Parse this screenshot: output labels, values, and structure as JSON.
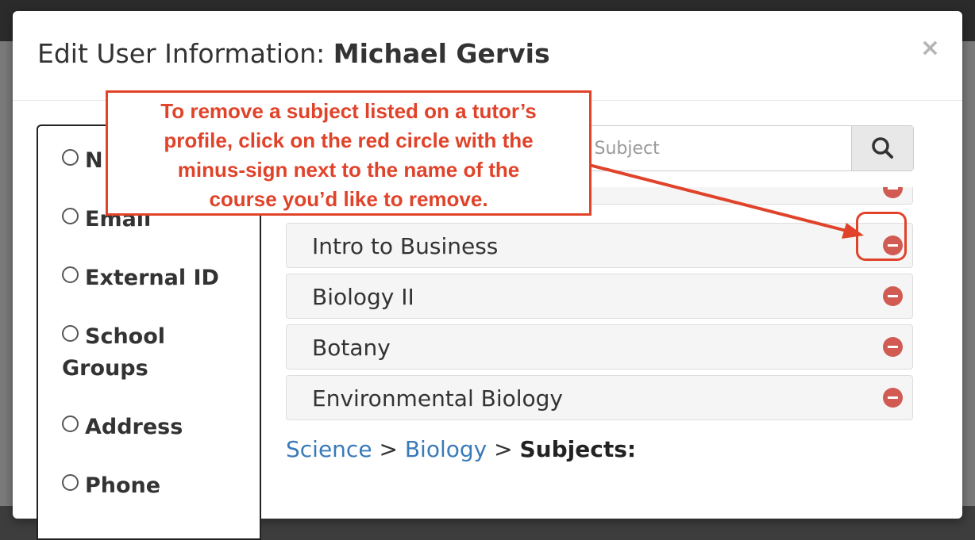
{
  "dialog": {
    "title_prefix": "Edit User Information:",
    "user_name": "Michael Gervis",
    "close_symbol": "×"
  },
  "fields": [
    {
      "label": "N"
    },
    {
      "label": "Email"
    },
    {
      "label": "External ID"
    },
    {
      "label": "School"
    },
    {
      "label": "Groups"
    },
    {
      "label": "Address"
    },
    {
      "label": "Phone"
    }
  ],
  "search": {
    "placeholder": "or Subject",
    "icon": "search-icon"
  },
  "subjects": [
    {
      "label": "Intro to Business"
    },
    {
      "label": "Biology II"
    },
    {
      "label": "Botany"
    },
    {
      "label": "Environmental Biology"
    }
  ],
  "breadcrumb": {
    "level1": "Science",
    "sep": ">",
    "level2": "Biology",
    "current": "Subjects:"
  },
  "callout": {
    "lines": [
      "To remove a subject listed on a tutor’s",
      "profile, click on the red circle with the",
      "minus-sign next to the name of the",
      "course you’d like to remove."
    ]
  },
  "colors": {
    "annotation": "#e0432a",
    "remove_icon": "#d15b53",
    "link": "#3a7ab8"
  }
}
